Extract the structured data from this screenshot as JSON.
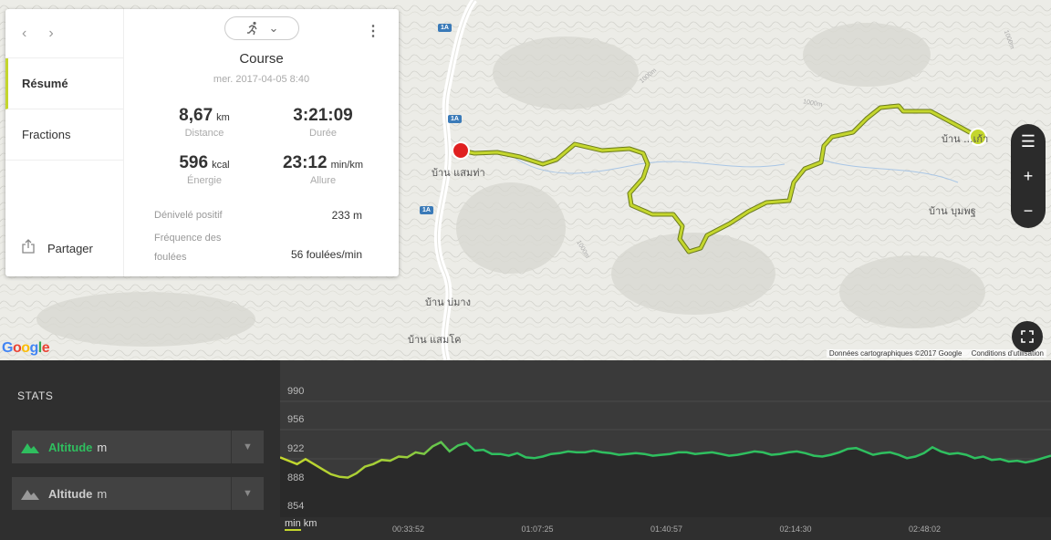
{
  "map": {
    "places": [
      "บ้าน แสมท่า",
      "บ้าน บ่มาง",
      "บ้าน แสมโค",
      "บ้าน บุมพฐ",
      "บ้าน ...เก้า"
    ],
    "roads": [
      "1A",
      "1A",
      "1A"
    ],
    "contours": [
      "1000m",
      "1000m",
      "1000m",
      "1000m"
    ],
    "logo": "Google",
    "attribution": "Données cartographiques ©2017 Google",
    "terms": "Conditions d'utilisation",
    "controls": {
      "layers": "☰",
      "zoom_in": "+",
      "zoom_out": "−",
      "fullscreen": "⛶"
    },
    "route_color": "#c4d62d",
    "start_color": "#e02020",
    "end_color": "#c4d62d"
  },
  "card": {
    "nav": {
      "prev": "‹",
      "next": "›"
    },
    "tabs": [
      "Résumé",
      "Fractions"
    ],
    "share_label": "Partager",
    "sport_icon": "running-icon",
    "title": "Course",
    "date": "mer. 2017-04-05 8:40",
    "stats": [
      {
        "value": "8,67",
        "unit": "km",
        "label": "Distance"
      },
      {
        "value": "3:21:09",
        "unit": "",
        "label": "Durée"
      },
      {
        "value": "596",
        "unit": "kcal",
        "label": "Énergie"
      },
      {
        "value": "23:12",
        "unit": "min/km",
        "label": "Allure"
      }
    ],
    "rows": [
      {
        "label": "Dénivelé positif",
        "value": "233  m"
      },
      {
        "label": "Fréquence des foulées",
        "value": "56 foulées/min"
      }
    ]
  },
  "stats_panel": {
    "title": "STATS",
    "selectors": [
      {
        "name": "Altitude",
        "unit": "m",
        "active": true
      },
      {
        "name": "Altitude",
        "unit": "m",
        "active": false
      }
    ]
  },
  "chart_data": {
    "type": "line",
    "y_ticks": [
      "990",
      "956",
      "922",
      "888",
      "854"
    ],
    "ylim": [
      854,
      990
    ],
    "x_ticks": [
      "00:33:52",
      "01:07:25",
      "01:40:57",
      "02:14:30",
      "02:48:02"
    ],
    "x_unit_active": "min",
    "x_unit_other": "km",
    "series": [
      {
        "values": [
          914,
          910,
          906,
          912,
          906,
          900,
          894,
          891,
          890,
          895,
          903,
          906,
          911,
          910,
          915,
          914,
          920,
          918,
          927,
          932,
          921,
          928,
          931,
          922,
          923,
          918,
          918,
          916,
          919,
          914,
          913,
          915,
          918,
          919,
          921,
          920,
          920,
          922,
          920,
          919,
          917,
          918,
          919,
          918,
          916,
          917,
          918,
          920,
          920,
          918,
          919,
          920,
          918,
          916,
          917,
          919,
          921,
          920,
          917,
          918,
          920,
          921,
          919,
          916,
          915,
          917,
          920,
          924,
          925,
          921,
          917,
          919,
          920,
          917,
          913,
          915,
          919,
          926,
          921,
          918,
          919,
          917,
          913,
          915,
          911,
          912,
          909,
          910,
          908,
          910,
          913,
          916
        ]
      }
    ]
  }
}
